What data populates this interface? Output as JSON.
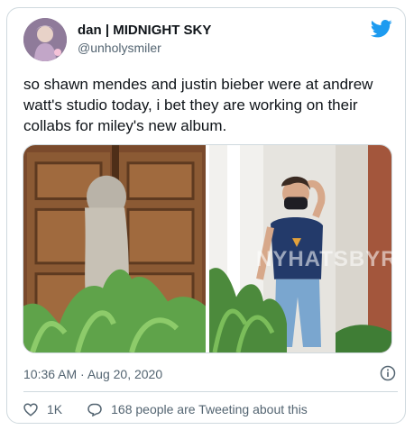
{
  "tweet": {
    "display_name": "dan | MIDNIGHT SKY",
    "handle": "@unholysmiler",
    "text": "so shawn mendes and justin bieber were at andrew watt's studio today, i bet they are working on their collabs for miley's new album.",
    "timestamp": "10:36 AM · Aug 20, 2020",
    "likes": "1K",
    "replies_text": "168 people are Tweeting about this",
    "watermark": "NYHATSBYR",
    "brand_color": "#1d9bf0",
    "icons": {
      "brand": "twitter-bird-icon",
      "info": "info-icon",
      "like": "heart-icon",
      "reply": "reply-bubble-icon"
    }
  }
}
